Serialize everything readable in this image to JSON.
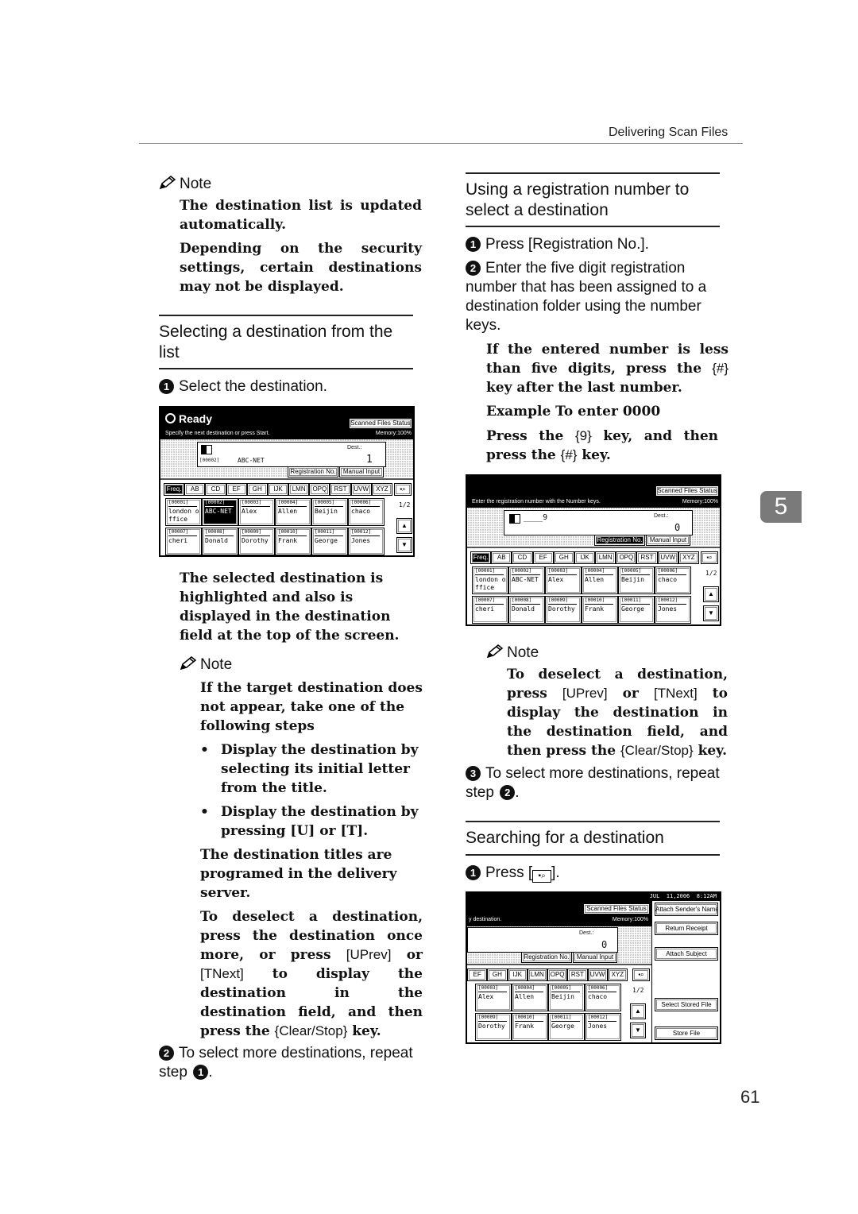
{
  "header": {
    "title": "Delivering Scan Files"
  },
  "chapter_tab": "5",
  "page_number": "61",
  "left": {
    "note1": {
      "label": "Note",
      "lines": [
        "The destination list is updated automatically.",
        "Depending on the security settings, certain destinations may not be displayed."
      ]
    },
    "section_title": "Selecting a destination from the list",
    "step1": {
      "num": "1",
      "text": "Select the destination."
    },
    "after_screen": "The selected destination is highlighted and also is displayed in the destination field at the top of the screen.",
    "note2": {
      "label": "Note",
      "intro": "If the target destination does not appear, take one of the following steps",
      "bullets": [
        "Display the destination by selecting its initial letter from the title.",
        "Display the destination by pressing [U] or [T]."
      ],
      "para1": "The destination titles are programed in the delivery server.",
      "para2_a": "To deselect a destination, press the destination once more, or press ",
      "prev": "[UPrev]",
      "or": " or ",
      "next": "[TNext]",
      "para2_b": " to display the destination in the destination field, and then press the ",
      "clear": "{Clear/Stop}",
      "key": " key."
    },
    "step2": {
      "num": "2",
      "text": "To select more destinations, repeat step ",
      "ref": "1"
    }
  },
  "right": {
    "section1_title": "Using a registration number to select a destination",
    "step1": {
      "num": "1",
      "text": "Press [Registration No.]."
    },
    "step2": {
      "num": "2",
      "text": "Enter the five digit registration number that has been assigned to a destination folder using the number keys."
    },
    "hint1_a": "If the entered number is less than five digits, press the ",
    "hint1_key": "{#}",
    "hint1_b": " key after the last number.",
    "example_title": "Example To enter 0000",
    "example_a": "Press the ",
    "example_key9": "{9}",
    "example_b": " key, and then press the ",
    "example_keyhash": "{#}",
    "example_c": " key.",
    "note": {
      "label": "Note",
      "a": "To deselect a destination, press ",
      "prev": "[UPrev]",
      "or": " or ",
      "next": "[TNext]",
      "b": " to display the destination in the destination field, and then press the ",
      "clear": "{Clear/Stop}",
      "c": " key."
    },
    "step3": {
      "num": "3",
      "text": "To select more destinations, repeat step ",
      "ref": "2"
    },
    "section2_title": "Searching for a destination",
    "search_step1": {
      "num": "1",
      "text_a": "Press [",
      "text_b": "]."
    }
  },
  "screen1": {
    "status": "Ready",
    "message": "Specify the next destination or press Start.",
    "scanned_files_status": "Scanned Files Status",
    "memory": "Memory:100%",
    "dest_reg": "[00002]",
    "dest_name": "ABC-NET",
    "dest_label": "Dest.:",
    "dest_count": "1",
    "registration_no": "Registration No.",
    "manual_input": "Manual Input",
    "tabs": [
      "Freq.",
      "AB",
      "CD",
      "EF",
      "GH",
      "IJK",
      "LMN",
      "OPQ",
      "RST",
      "UVW",
      "XYZ"
    ],
    "page_indicator": "1/2",
    "entries": [
      {
        "reg": "[00001]",
        "name": "london o\nffice",
        "selected": false
      },
      {
        "reg": "[00002]",
        "name": "ABC-NET",
        "selected": true
      },
      {
        "reg": "[00003]",
        "name": "Alex",
        "selected": false
      },
      {
        "reg": "[00004]",
        "name": "Allen",
        "selected": false
      },
      {
        "reg": "[00005]",
        "name": "Beijin",
        "selected": false
      },
      {
        "reg": "[00006]",
        "name": "chaco",
        "selected": false
      },
      {
        "reg": "[00007]",
        "name": "cheri",
        "selected": false
      },
      {
        "reg": "[00008]",
        "name": "Donald",
        "selected": false
      },
      {
        "reg": "[00009]",
        "name": "Dorothy",
        "selected": false
      },
      {
        "reg": "[00010]",
        "name": "Frank",
        "selected": false
      },
      {
        "reg": "[00011]",
        "name": "George",
        "selected": false
      },
      {
        "reg": "[00012]",
        "name": "Jones",
        "selected": false
      }
    ]
  },
  "screen2": {
    "message": "Enter the registration number with the Number keys.",
    "scanned_files_status": "Scanned Files Status",
    "memory": "Memory:100%",
    "entry_value": "____9",
    "dest_label": "Dest.:",
    "dest_count": "0",
    "registration_no": "Registration No.",
    "manual_input": "Manual Input",
    "tabs": [
      "Freq.",
      "AB",
      "CD",
      "EF",
      "GH",
      "IJK",
      "LMN",
      "OPQ",
      "RST",
      "UVW",
      "XYZ"
    ],
    "page_indicator": "1/2",
    "entries": [
      {
        "reg": "[00001]",
        "name": "london o\nffice"
      },
      {
        "reg": "[00002]",
        "name": "ABC-NET"
      },
      {
        "reg": "[00003]",
        "name": "Alex"
      },
      {
        "reg": "[00004]",
        "name": "Allen"
      },
      {
        "reg": "[00005]",
        "name": "Beijin"
      },
      {
        "reg": "[00006]",
        "name": "chaco"
      },
      {
        "reg": "[00007]",
        "name": "cheri"
      },
      {
        "reg": "[00008]",
        "name": "Donald"
      },
      {
        "reg": "[00009]",
        "name": "Dorothy"
      },
      {
        "reg": "[00010]",
        "name": "Frank"
      },
      {
        "reg": "[00011]",
        "name": "George"
      },
      {
        "reg": "[00012]",
        "name": "Jones"
      }
    ]
  },
  "screen3": {
    "datetime": "JUL  11,2006  8:12AM",
    "message": "y destination.",
    "scanned_files_status": "Scanned Files Status",
    "memory": "Memory:100%",
    "dest_label": "Dest.:",
    "dest_count": "0",
    "registration_no": "Registration No.",
    "manual_input": "Manual Input",
    "tabs": [
      "EF",
      "GH",
      "IJK",
      "LMN",
      "OPQ",
      "RST",
      "UVW",
      "XYZ"
    ],
    "page_indicator": "1/2",
    "side_buttons": [
      "Attach Sender's Name",
      "Return Receipt",
      "Attach Subject",
      "Select Stored File",
      "Store File"
    ],
    "entries": [
      {
        "reg": "[00003]",
        "name": "Alex"
      },
      {
        "reg": "[00004]",
        "name": "Allen"
      },
      {
        "reg": "[00005]",
        "name": "Beijin"
      },
      {
        "reg": "[00006]",
        "name": "chaco"
      },
      {
        "reg": "[00009]",
        "name": "Dorothy"
      },
      {
        "reg": "[00010]",
        "name": "Frank"
      },
      {
        "reg": "[00011]",
        "name": "George"
      },
      {
        "reg": "[00012]",
        "name": "Jones"
      }
    ]
  }
}
